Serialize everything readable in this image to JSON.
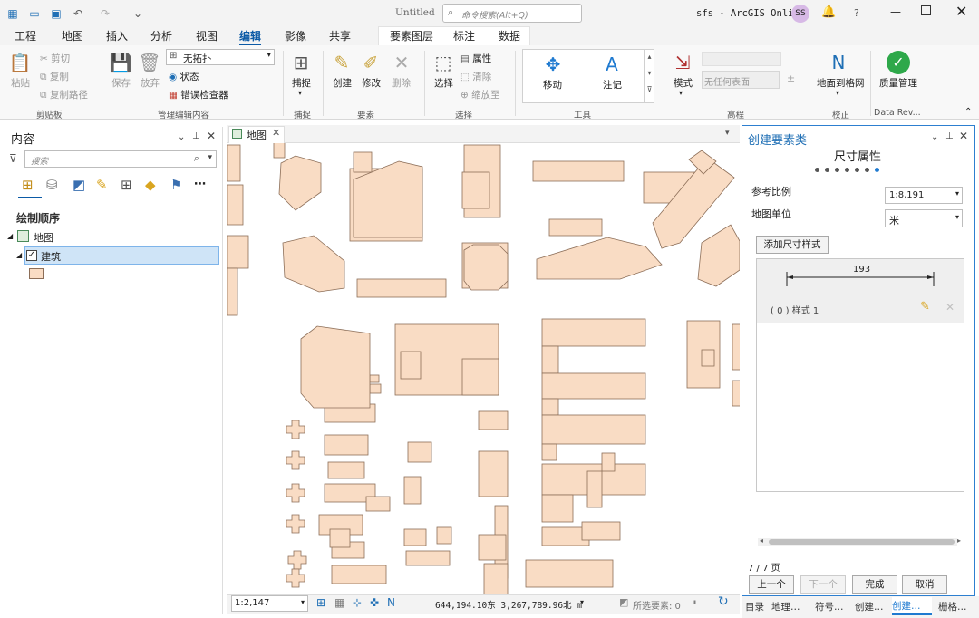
{
  "titlebar": {
    "doc_title": "Untitled",
    "search_placeholder": "命令搜索(Alt+Q)",
    "account": "sfs - ArcGIS Online",
    "avatar": "SS",
    "help": "?"
  },
  "menu_tabs": [
    "工程",
    "地图",
    "插入",
    "分析",
    "视图",
    "编辑",
    "影像",
    "共享"
  ],
  "context_tabs": [
    "要素图层",
    "标注",
    "数据"
  ],
  "ribbon": {
    "clipboard": {
      "paste": "粘贴",
      "cut": "剪切",
      "copy": "复制",
      "copy_path": "复制路径",
      "group": "剪贴板"
    },
    "manage": {
      "save": "保存",
      "discard": "放弃",
      "topology": "无拓扑",
      "status": "状态",
      "error_inspector": "错误检查器",
      "group": "管理编辑内容"
    },
    "snapping": {
      "label": "捕捉",
      "group": "捕捉"
    },
    "features": {
      "create": "创建",
      "modify": "修改",
      "delete": "删除",
      "group": "要素"
    },
    "selection": {
      "select": "选择",
      "attributes": "属性",
      "clear": "清除",
      "zoom": "缩放至",
      "group": "选择"
    },
    "tools": {
      "move": "移动",
      "annotate": "注记",
      "group": "工具"
    },
    "elevation": {
      "mode": "模式",
      "surface": "无任何表面",
      "group": "高程"
    },
    "verify": {
      "label": "地面到格网",
      "group": "校正"
    },
    "dr": {
      "label": "质量管理",
      "group": "Data Rev..."
    }
  },
  "contents": {
    "title": "内容",
    "search_placeholder": "搜索",
    "drawing_order": "绘制顺序",
    "map": "地图",
    "layer": "建筑"
  },
  "map_tab": "地图",
  "status": {
    "scale": "1:2,147",
    "coords": "644,194.10东 3,267,789.96北 m",
    "selected": "所选要素: 0"
  },
  "create_pane": {
    "title": "创建要素类",
    "subtitle": "尺寸属性",
    "scale_label": "参考比例",
    "scale_value": "1:8,191",
    "unit_label": "地图单位",
    "unit_value": "米",
    "add_style": "添加尺寸样式",
    "dim_value": "193",
    "style_item": "( 0 ) 样式 1",
    "page": "7 / 7 页",
    "prev": "上一个",
    "next": "下一个",
    "finish": "完成",
    "cancel": "取消",
    "steps": 7,
    "current_step": 7
  },
  "bottom_tabs": [
    "目录",
    "地理…",
    "符号…",
    "创建…",
    "创建…",
    "栅格…"
  ],
  "colors": {
    "building_fill": "#f9dcc4",
    "building_stroke": "#8c6e58",
    "accent": "#0b5aa6"
  }
}
